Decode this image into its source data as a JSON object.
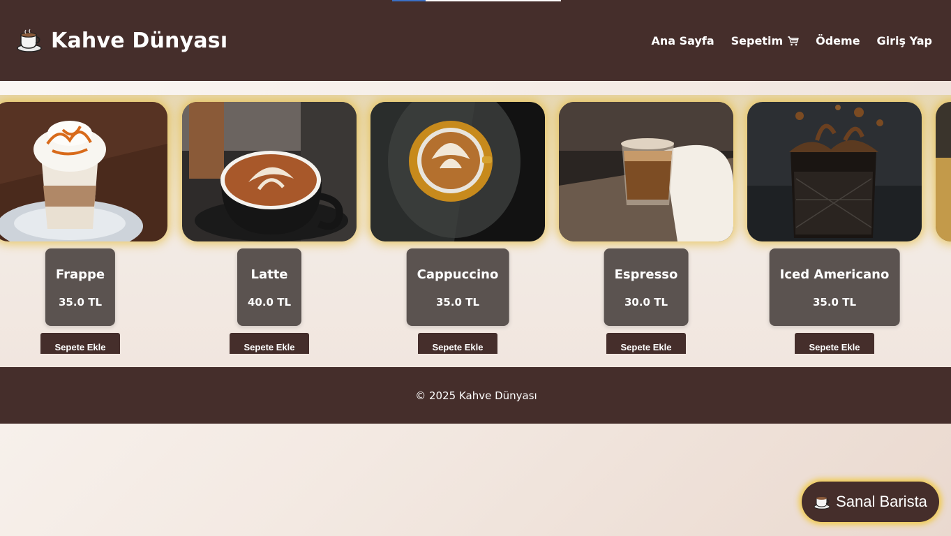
{
  "header": {
    "logo_icon": "coffee-cup-icon",
    "title": "Kahve Dünyası",
    "nav": [
      {
        "label": "Ana Sayfa"
      },
      {
        "label": "Sepetim",
        "icon": "cart-icon"
      },
      {
        "label": "Ödeme"
      },
      {
        "label": "Giriş Yap"
      }
    ]
  },
  "products": [
    {
      "name": "Frappe",
      "price": "35.0 TL",
      "button": "Sepete Ekle"
    },
    {
      "name": "Latte",
      "price": "40.0 TL",
      "button": "Sepete Ekle"
    },
    {
      "name": "Cappuccino",
      "price": "35.0 TL",
      "button": "Sepete Ekle"
    },
    {
      "name": "Espresso",
      "price": "30.0 TL",
      "button": "Sepete Ekle"
    },
    {
      "name": "Iced Americano",
      "price": "35.0 TL",
      "button": "Sepete Ekle"
    }
  ],
  "footer": {
    "text": "© 2025 Kahve Dünyası"
  },
  "barista": {
    "label": "Sanal Barista",
    "icon": "coffee-cup-icon"
  },
  "colors": {
    "brand": "#452e2b",
    "card": "#5b5350",
    "glow": "#e6be46"
  }
}
